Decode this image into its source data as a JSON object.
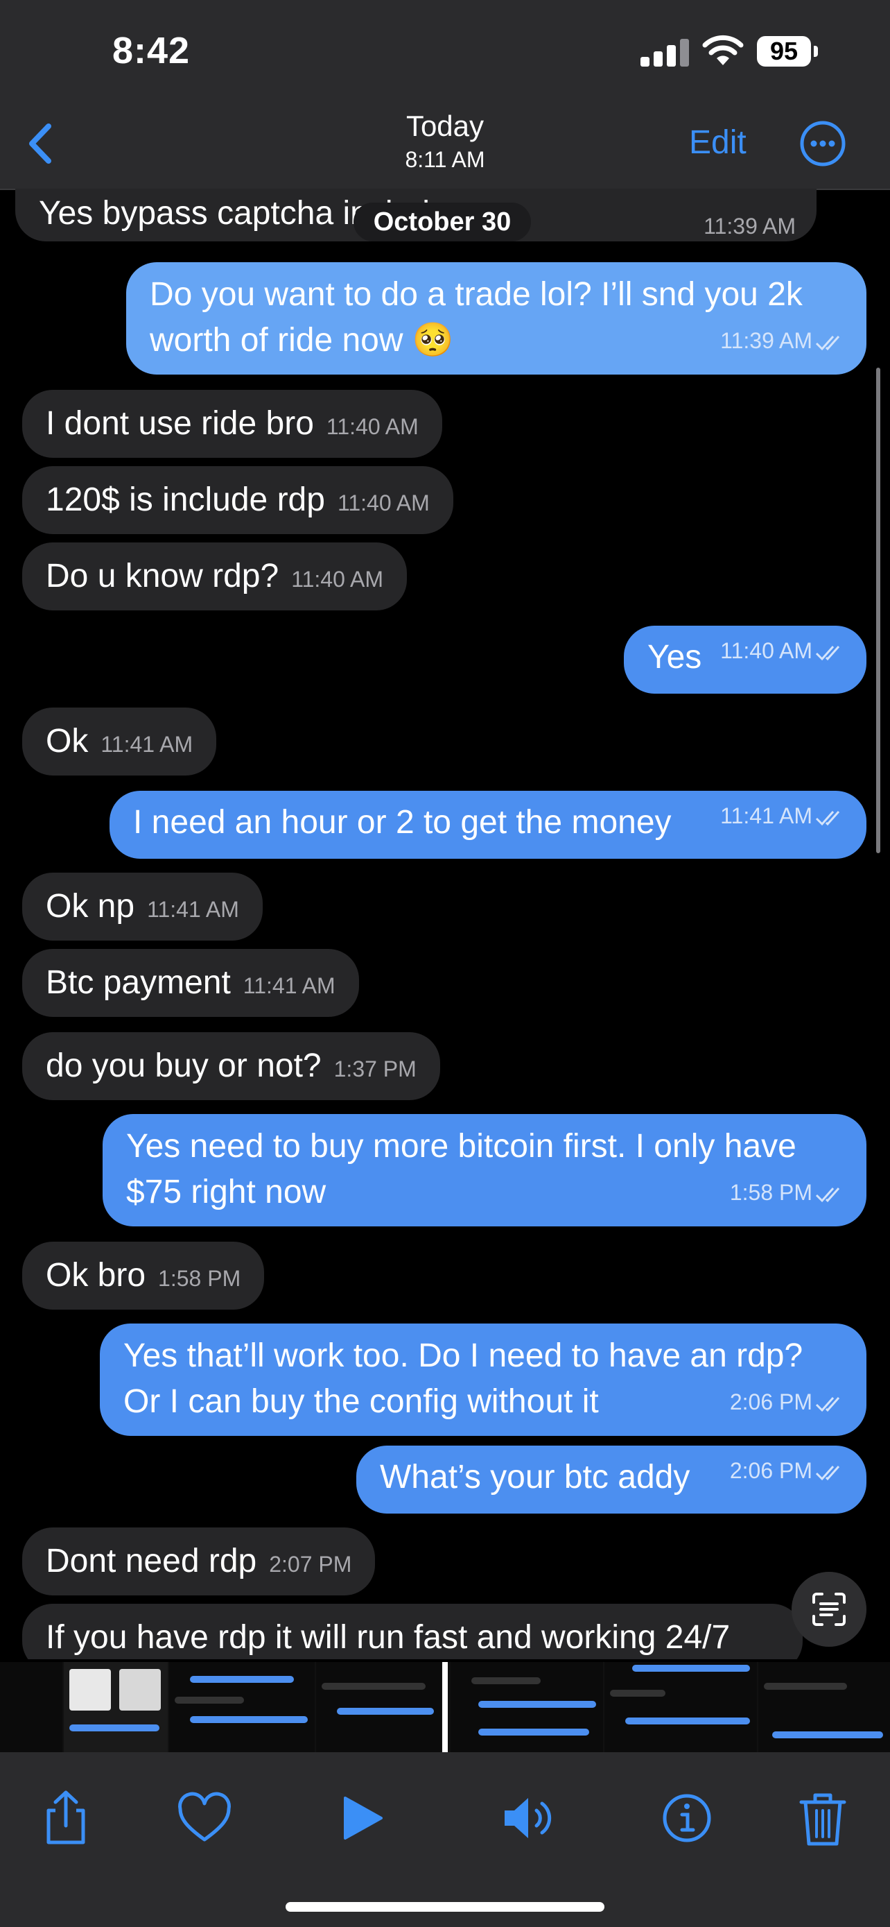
{
  "status": {
    "time": "8:42",
    "battery": "95"
  },
  "nav": {
    "date": "Today",
    "time": "8:11 AM",
    "edit": "Edit"
  },
  "chat": {
    "date_separator": "October 30",
    "messages": [
      {
        "text": "Yes bypass captcha include",
        "time": "11:39 AM"
      },
      {
        "text_line1": "Do you want to do a trade lol? I’ll snd you 2k",
        "text_line2": "worth of ride now 🥺",
        "time": "11:39 AM"
      },
      {
        "text": "I dont use ride bro",
        "time": "11:40 AM"
      },
      {
        "text": "120$ is include rdp",
        "time": "11:40 AM"
      },
      {
        "text": "Do u know rdp?",
        "time": "11:40 AM"
      },
      {
        "text": "Yes",
        "time": "11:40 AM"
      },
      {
        "text": "Ok",
        "time": "11:41 AM"
      },
      {
        "text": "I need an hour or 2 to get the money",
        "time": "11:41 AM"
      },
      {
        "text": "Ok np",
        "time": "11:41 AM"
      },
      {
        "text": "Btc payment",
        "time": "11:41 AM"
      },
      {
        "text": "do you buy or not?",
        "time": "1:37 PM"
      },
      {
        "text_line1": "Yes need to buy more bitcoin first. I only have",
        "text_line2": "$75 right now",
        "time": "1:58 PM"
      },
      {
        "text": "Ok bro",
        "time": "1:58 PM"
      },
      {
        "text_line1": "Yes that’ll work too. Do I need to have an rdp?",
        "text_line2": "Or I can buy the config without it",
        "time": "2:06 PM"
      },
      {
        "text": "What’s your btc addy",
        "time": "2:06 PM"
      },
      {
        "text": "Dont need rdp",
        "time": "2:07 PM"
      },
      {
        "text": "If you have rdp it will run fast and working 24/7"
      }
    ]
  },
  "toolbar": {
    "icons": [
      "share-icon",
      "heart-icon",
      "play-icon",
      "speaker-icon",
      "info-icon",
      "trash-icon"
    ]
  },
  "colors": {
    "accent": "#3b8ff6",
    "outgoing": "#4c8ff0",
    "incoming": "#262628"
  }
}
